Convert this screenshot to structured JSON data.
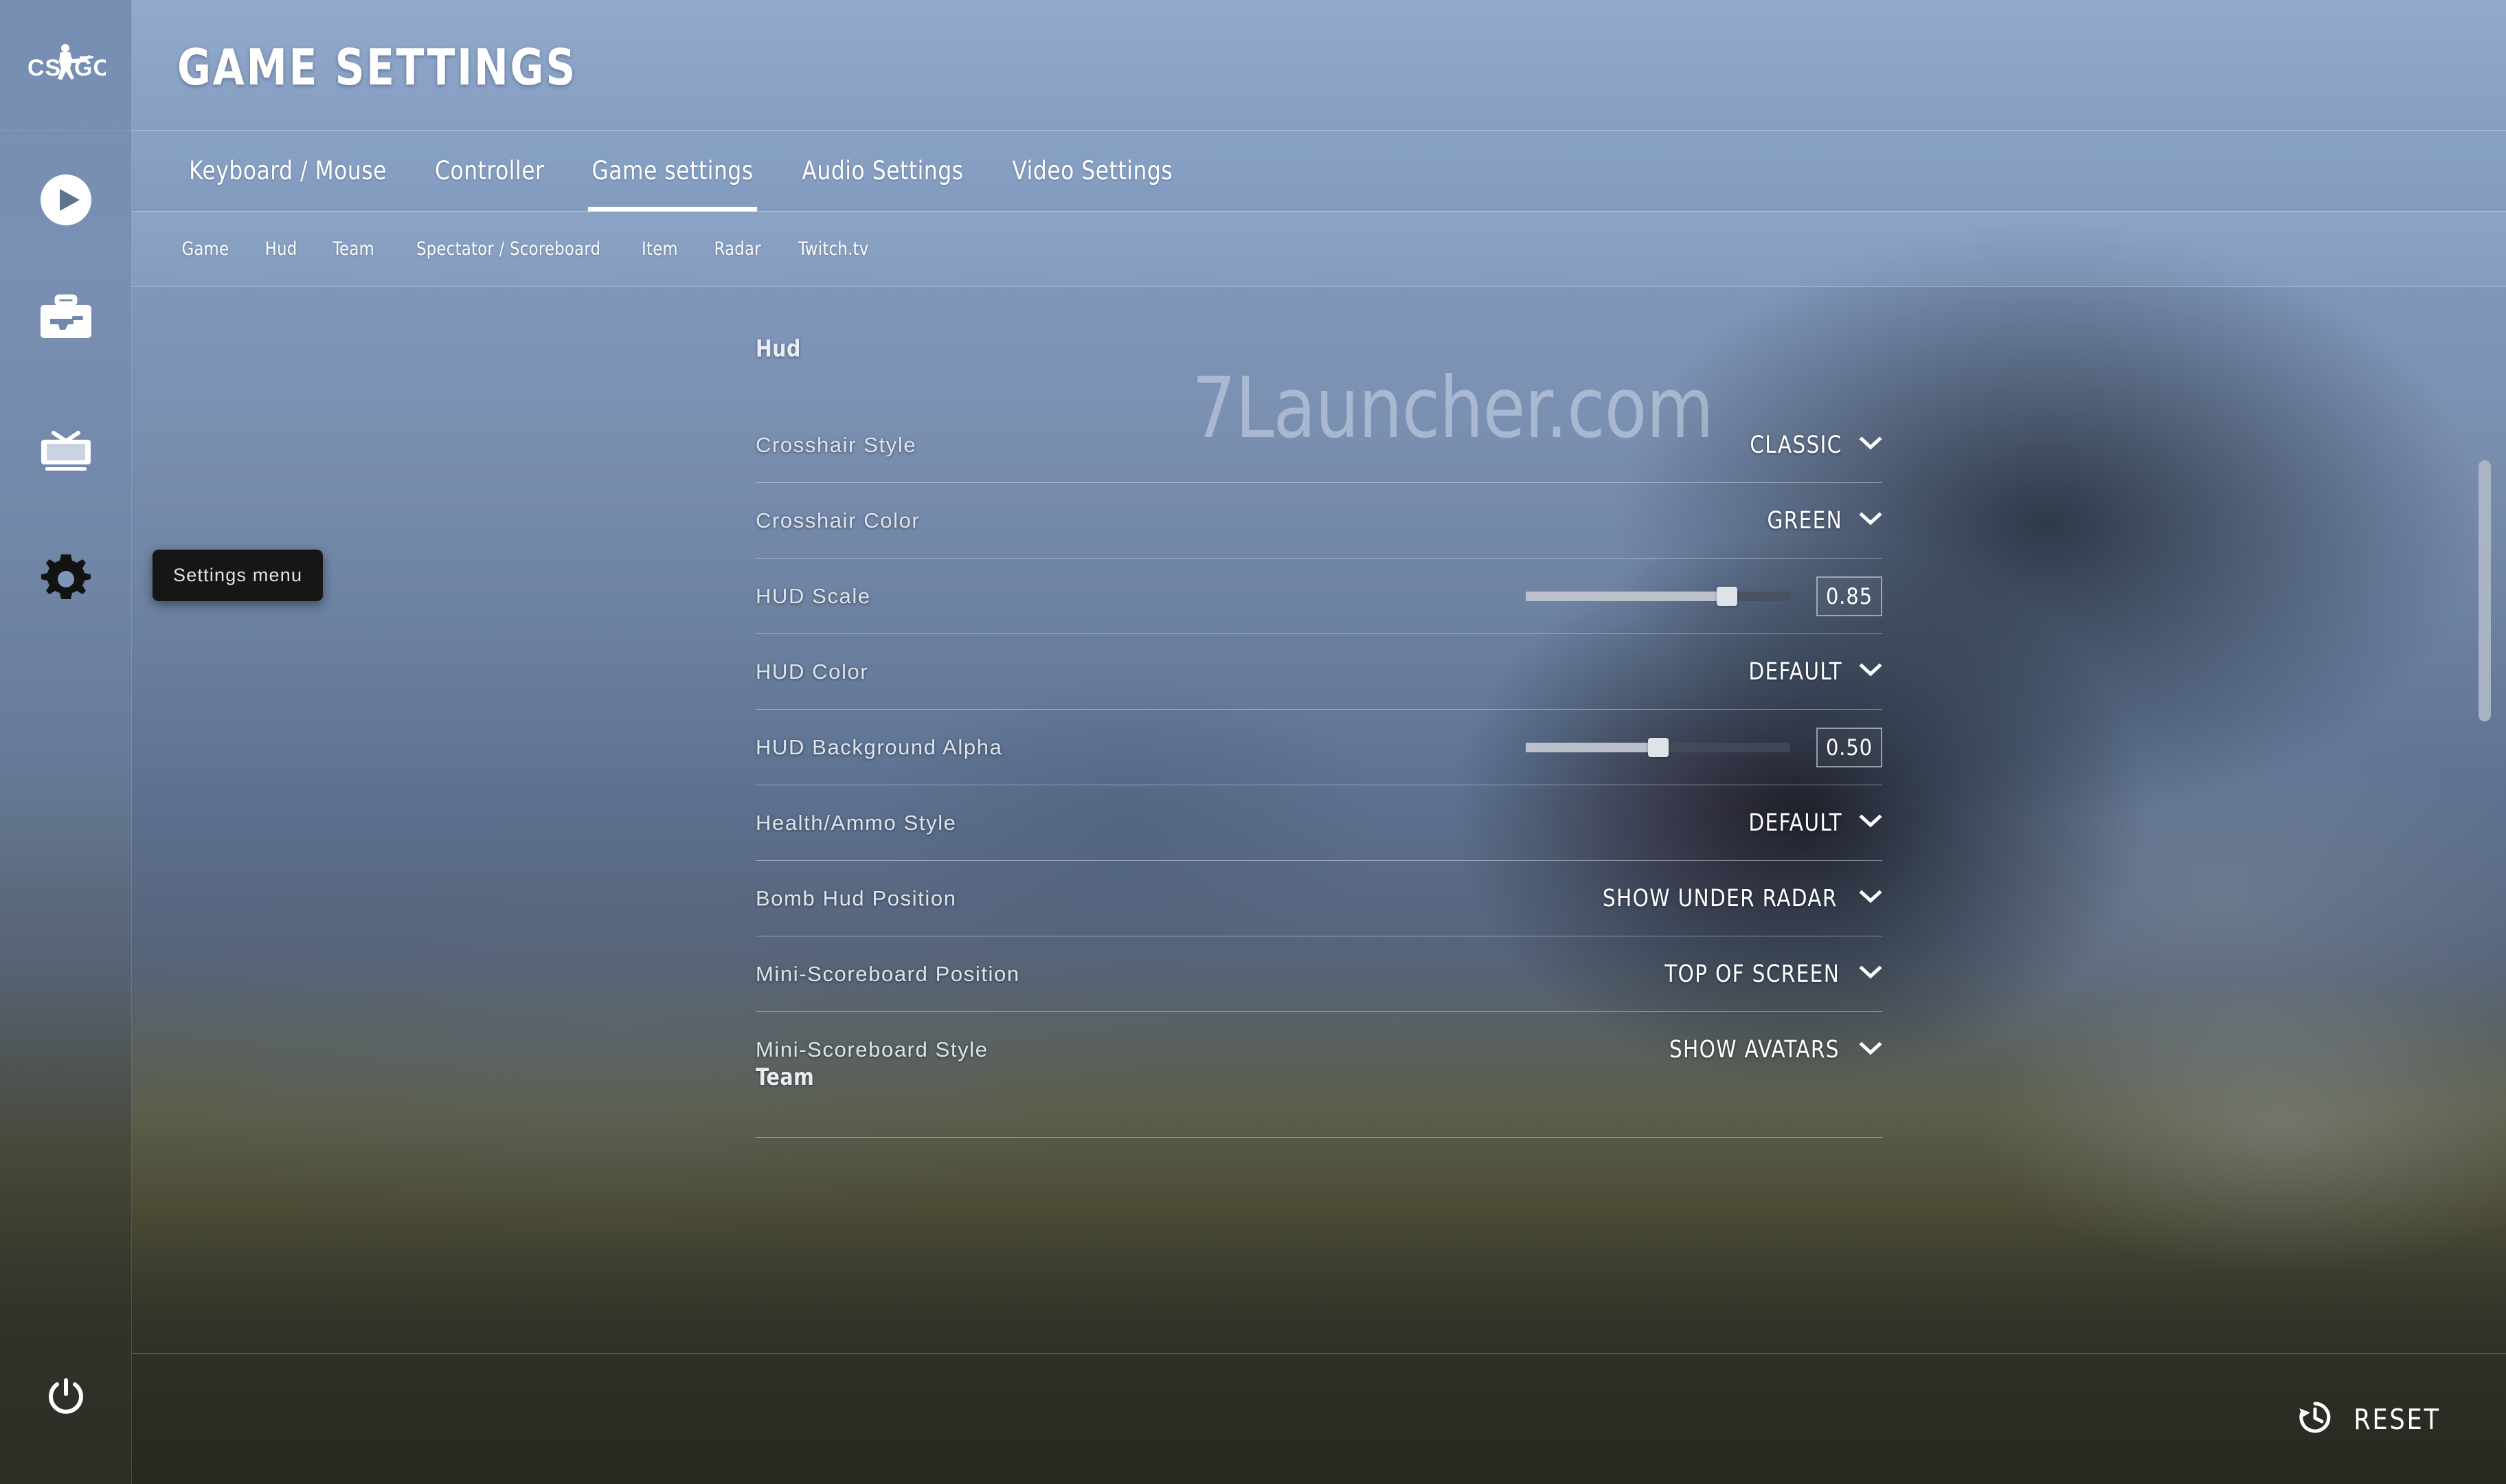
{
  "app": {
    "logo_text": "CS:GO",
    "title": "GAME SETTINGS",
    "watermark": "7Launcher.com"
  },
  "rail": {
    "items": [
      {
        "name": "play",
        "icon": "play-icon"
      },
      {
        "name": "inventory",
        "icon": "weapon-case-icon"
      },
      {
        "name": "watch",
        "icon": "tv-icon"
      },
      {
        "name": "settings",
        "icon": "gear-icon"
      },
      {
        "name": "quit",
        "icon": "power-icon"
      }
    ]
  },
  "tooltip": {
    "text": "Settings menu"
  },
  "tabs": {
    "items": [
      {
        "label": "Keyboard / Mouse",
        "active": false
      },
      {
        "label": "Controller",
        "active": false
      },
      {
        "label": "Game settings",
        "active": true
      },
      {
        "label": "Audio Settings",
        "active": false
      },
      {
        "label": "Video Settings",
        "active": false
      }
    ]
  },
  "subtabs": {
    "items": [
      {
        "label": "Game"
      },
      {
        "label": "Hud"
      },
      {
        "label": "Team"
      },
      {
        "label": "Spectator / Scoreboard"
      },
      {
        "label": "Item"
      },
      {
        "label": "Radar"
      },
      {
        "label": "Twitch.tv"
      }
    ]
  },
  "sections": {
    "hud_title": "Hud",
    "team_title": "Team"
  },
  "settings": [
    {
      "label": "Crosshair Style",
      "type": "dropdown",
      "value": "Classic"
    },
    {
      "label": "Crosshair Color",
      "type": "dropdown",
      "value": "Green"
    },
    {
      "label": "HUD Scale",
      "type": "slider",
      "value": "0.85",
      "percent": 76
    },
    {
      "label": "HUD Color",
      "type": "dropdown",
      "value": "Default"
    },
    {
      "label": "HUD Background Alpha",
      "type": "slider",
      "value": "0.50",
      "percent": 50
    },
    {
      "label": "Health/Ammo Style",
      "type": "dropdown",
      "value": "Default"
    },
    {
      "label": "Bomb Hud Position",
      "type": "dropdown",
      "value": "Show Under Radar"
    },
    {
      "label": "Mini-Scoreboard Position",
      "type": "dropdown",
      "value": "Top of Screen"
    },
    {
      "label": "Mini-Scoreboard Style",
      "type": "dropdown",
      "value": "Show Avatars"
    }
  ],
  "footer": {
    "reset_label": "RESET",
    "reset_icon": "history-restore-icon"
  },
  "colors": {
    "accent": "#ffffff",
    "header_blue": "#8fa9cd",
    "rail_blue": "#748cb0",
    "tooltip_bg": "#161616",
    "footer_dark": "#30302 8"
  }
}
